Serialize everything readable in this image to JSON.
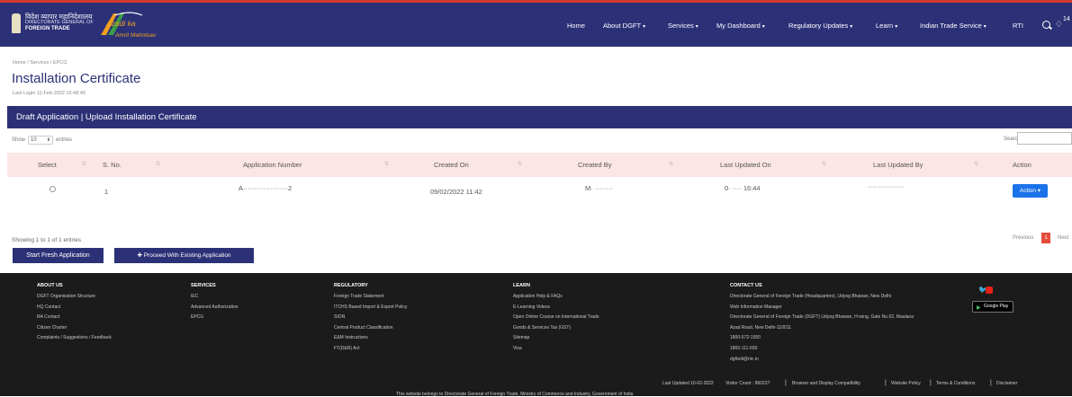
{
  "header": {
    "brand_hindi": "विदेश व्यापार महानिदेशालय",
    "brand_line2": "DIRECTORATE GENERAL OF",
    "brand_line3": "FOREIGN TRADE",
    "azadi_line1": "Azadi ka",
    "azadi_line2": "Amrit Mahotsav",
    "nav": [
      {
        "label": "Home",
        "dropdown": false
      },
      {
        "label": "About DGFT",
        "dropdown": true
      },
      {
        "label": "Services",
        "dropdown": true
      },
      {
        "label": "My Dashboard",
        "dropdown": true
      },
      {
        "label": "Regulatory Updates",
        "dropdown": true
      },
      {
        "label": "Learn",
        "dropdown": true
      },
      {
        "label": "Indian Trade Service",
        "dropdown": true
      },
      {
        "label": "RTI",
        "dropdown": false
      }
    ],
    "notification_count": "14",
    "colors": {
      "header_bg": "#2c3177",
      "accent": "#d23a30"
    }
  },
  "page": {
    "breadcrumb": "Home / Services / EPCG",
    "title": "Installation Certificate",
    "last_login": "Last Login 11-Feb-2022 16:48:49",
    "section_bar": "Draft Application | Upload Installation Certificate"
  },
  "table_controls": {
    "show_label": "Show",
    "entries_value": "10",
    "entries_label": "entries",
    "search_label": "Search:"
  },
  "table": {
    "columns": [
      "Select",
      "S. No.",
      "Application Number",
      "Created On",
      "Created By",
      "Last Updated On",
      "Last Updated By",
      "Action"
    ],
    "rows": [
      {
        "sno": "1",
        "application_number": "A····················2",
        "created_on": "09/02/2022 11:42",
        "created_by": "M·  ········",
        "last_updated_on": "0·  ···· 16:44",
        "last_updated_by": "················",
        "action_label": "Action"
      }
    ],
    "colors": {
      "header_bg": "#fbe5e5",
      "action_button": "#1a73e8"
    }
  },
  "pagination": {
    "showing": "Showing 1 to 1 of 1 entries",
    "previous": "Previous",
    "current_page": "1",
    "next": "Next"
  },
  "buttons": {
    "start_fresh": "Start Fresh Application",
    "proceed_existing": "Proceed With Existing Application"
  },
  "footer": {
    "about": {
      "heading": "ABOUT US",
      "items": [
        "DGFT Organisation Structure",
        "HQ Contact",
        "RA Contact",
        "Citizen Charter",
        "Complaints / Suggestions / Feedback"
      ]
    },
    "services": {
      "heading": "SERVICES",
      "items": [
        "IEC",
        "Advanced Authorization",
        "EPCG"
      ]
    },
    "regulatory": {
      "heading": "REGULATORY",
      "items": [
        "Foreign Trade Statement",
        "ITCHS Based Import & Export Policy",
        "SION",
        "Central Product Classification",
        "E&M Instructions",
        "FT(D&R) Act"
      ]
    },
    "learn": {
      "heading": "LEARN",
      "items": [
        "Application Help & FAQs",
        "E-Learning Videos",
        "Open Online Course on International Trade",
        "Goods & Services Tax (GST)",
        "Sitemap",
        "Visa"
      ]
    },
    "contact": {
      "heading": "CONTACT US",
      "items": [
        "Directorate General of Foreign Trade (Headquarters), Udyog Bhawan, New Delhi",
        "Web Information Manager",
        "Directorate General of Foreign Trade (DGFT) Udyog Bhawan, H-wing, Gate No.02, Maulana",
        "Azad Road, New Delhi-110011",
        "1800-572-1550",
        "1800-111-550",
        "dgftedi@nic.in"
      ]
    },
    "google_play": "Google Play",
    "bottom": {
      "last_updated": "Last Updated 10-02-2022",
      "visitor_count": "Visitor Count : 860227",
      "browser": "Browser and Display Compatibility",
      "website_policy": "Website Policy",
      "terms": "Terms & Conditions",
      "disclaimer": "Disclaimer",
      "ownership": "This website belongs to Directorate General of Foreign Trade, Ministry of Commerce and Industry, Government of India"
    }
  }
}
